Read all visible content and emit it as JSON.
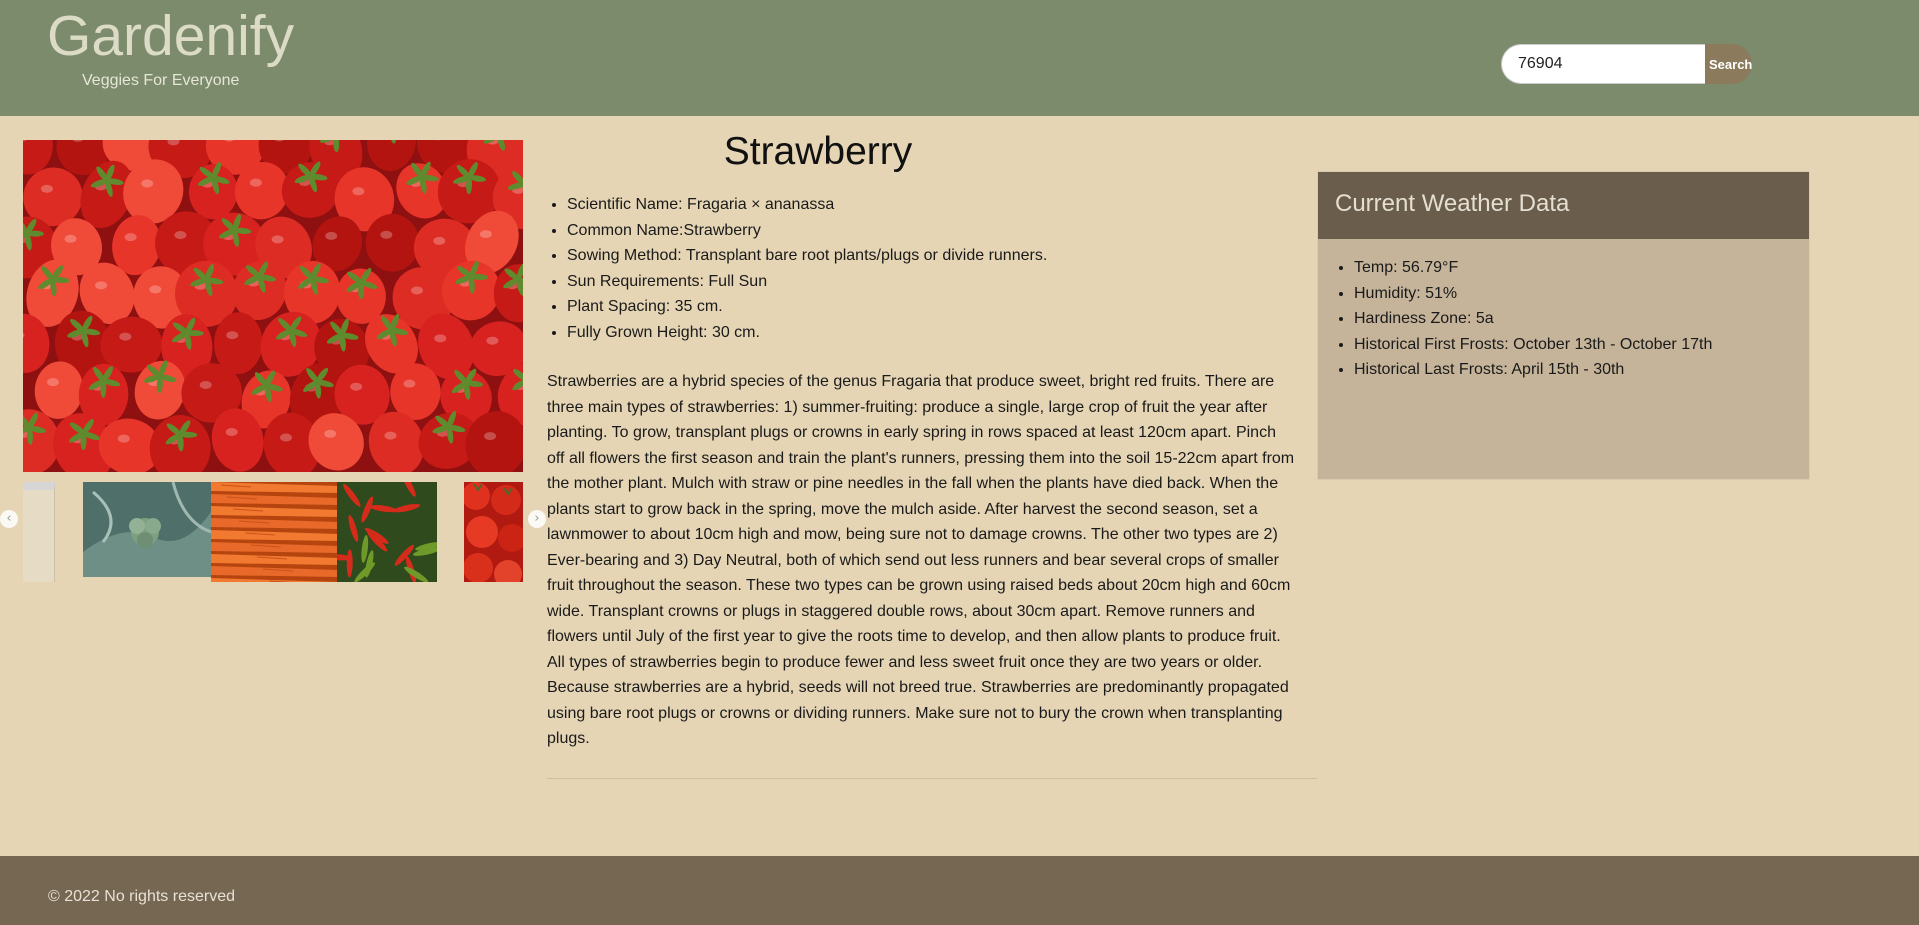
{
  "header": {
    "logo": "Gardenify",
    "tagline": "Veggies For Everyone",
    "search_value": "76904",
    "search_button": "Search"
  },
  "gallery": {
    "main_image": "strawberry-photo",
    "thumbnails": [
      "broccoli-photo",
      "carrots-photo",
      "chili-peppers-photo",
      "tomatoes-photo"
    ]
  },
  "plant": {
    "name": "Strawberry",
    "facts": [
      "Scientific Name: Fragaria × ananassa",
      "Common Name:Strawberry",
      "Sowing Method: Transplant bare root plants/plugs or divide runners.",
      "Sun Requirements: Full Sun",
      "Plant Spacing: 35 cm.",
      "Fully Grown Height: 30 cm."
    ],
    "description": "Strawberries are a hybrid species of the genus Fragaria that produce sweet, bright red fruits. There are three main types of strawberries: 1) summer-fruiting: produce a single, large crop of fruit the year after planting. To grow, transplant plugs or crowns in early spring in rows spaced at least 120cm apart. Pinch off all flowers the first season and train the plant's runners, pressing them into the soil 15-22cm apart from the mother plant. Mulch with straw or pine needles in the fall when the plants have died back. When the plants start to grow back in the spring, move the mulch aside. After harvest the second season, set a lawnmower to about 10cm high and mow, being sure not to damage crowns. The other two types are 2) Ever-bearing and 3) Day Neutral, both of which send out less runners and bear several crops of smaller fruit throughout the season. These two types can be grown using raised beds about 20cm high and 60cm wide. Transplant crowns or plugs in staggered double rows, about 30cm apart. Remove runners and flowers until July of the first year to give the roots time to develop, and then allow plants to produce fruit. All types of strawberries begin to produce fewer and less sweet fruit once they are two years or older. Because strawberries are a hybrid, seeds will not breed true. Strawberries are predominantly propagated using bare root plugs or crowns or dividing runners. Make sure not to bury the crown when transplanting plugs."
  },
  "weather": {
    "title": "Current Weather Data",
    "items": [
      "Temp: 56.79°F",
      "Humidity: 51%",
      "Hardiness Zone: 5a",
      "Historical First Frosts: October 13th - October 17th",
      "Historical Last Frosts: April 15th - 30th"
    ]
  },
  "footer": {
    "copyright": "© 2022 No rights reserved"
  },
  "colors": {
    "header_bg": "#7b8b6b",
    "page_bg": "#e5d5b5",
    "weather_header_bg": "#6b5d4b",
    "weather_body_bg": "#c5b49a",
    "footer_bg": "#766753",
    "search_button_bg": "#8b7a5b"
  }
}
